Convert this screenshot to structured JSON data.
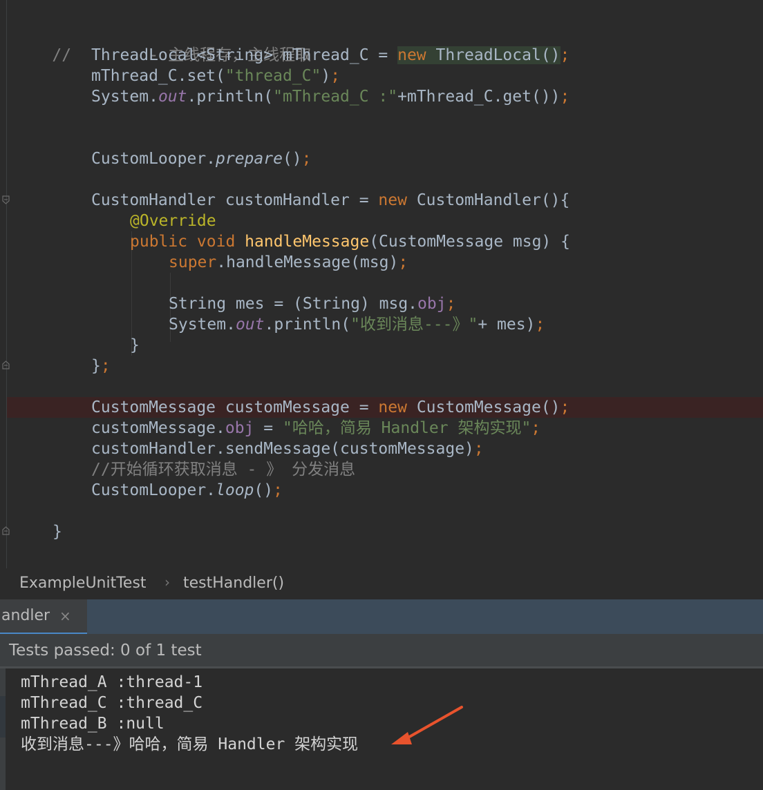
{
  "editor": {
    "lines": {
      "l1_comment_prefix": "//",
      "l1_comment_text": "- 主线程存，主线程取",
      "l2_type": "ThreadLocal<String> mThread_C = ",
      "l2_new": "new",
      "l2_ctor": " ThreadLocal()",
      "l2_semi": ";",
      "l3_a": "mThread_C.set(",
      "l3_str": "\"thread_C\"",
      "l3_b": ")",
      "l3_semi": ";",
      "l4_a": "System.",
      "l4_out": "out",
      "l4_b": ".println(",
      "l4_str": "\"mThread_C :\"",
      "l4_c": "+mThread_C.get())",
      "l4_semi": ";",
      "l5_a": "CustomLooper.",
      "l5_m": "prepare",
      "l5_b": "()",
      "l5_semi": ";",
      "l6_a": "CustomHandler customHandler = ",
      "l6_new": "new",
      "l6_b": " CustomHandler(){",
      "l7_ann": "@Override",
      "l8_kw": "public void ",
      "l8_m": "handleMessage",
      "l8_b": "(CustomMessage msg) {",
      "l9_kw": "super",
      "l9_b": ".handleMessage(msg)",
      "l9_semi": ";",
      "l10_a": "String mes = (String) msg.",
      "l10_f": "obj",
      "l10_semi": ";",
      "l11_a": "System.",
      "l11_out": "out",
      "l11_b": ".println(",
      "l11_str": "\"收到消息---》\"",
      "l11_c": "+ mes)",
      "l11_semi": ";",
      "l12": "}",
      "l13_a": "}",
      "l13_semi": ";",
      "l14_a": "CustomMessage customMessage = ",
      "l14_new": "new",
      "l14_b": " CustomMessage()",
      "l14_semi": ";",
      "l15_a": "customMessage.",
      "l15_f": "obj",
      "l15_b": " = ",
      "l15_str": "\"哈哈，简易 Handler 架构实现\"",
      "l15_semi": ";",
      "l16_a": "customHandler.sendMessage(customMessage)",
      "l16_semi": ";",
      "l17_comment": "//开始循环获取消息 - 》 分发消息",
      "l18_a": "CustomLooper.",
      "l18_m": "loop",
      "l18_b": "()",
      "l18_semi": ";",
      "l19": "}"
    }
  },
  "breadcrumb": {
    "class_name": "ExampleUnitTest",
    "separator": "›",
    "method_name": "testHandler()"
  },
  "run_tab": {
    "label": "andler",
    "close": "×"
  },
  "status": {
    "text": "Tests passed: 0 of 1 test"
  },
  "console": {
    "lines": [
      "mThread_A :thread-1",
      "mThread_C :thread_C",
      "mThread_B :null",
      "收到消息---》哈哈，简易 Handler 架构实现"
    ]
  },
  "colors": {
    "editor_bg": "#2b2b2b",
    "keyword": "#cc7832",
    "string": "#6a8759",
    "field": "#9876aa",
    "method_decl": "#ffc66d",
    "annotation": "#bbb529",
    "comment": "#808080",
    "arrow": "#e8532d"
  }
}
